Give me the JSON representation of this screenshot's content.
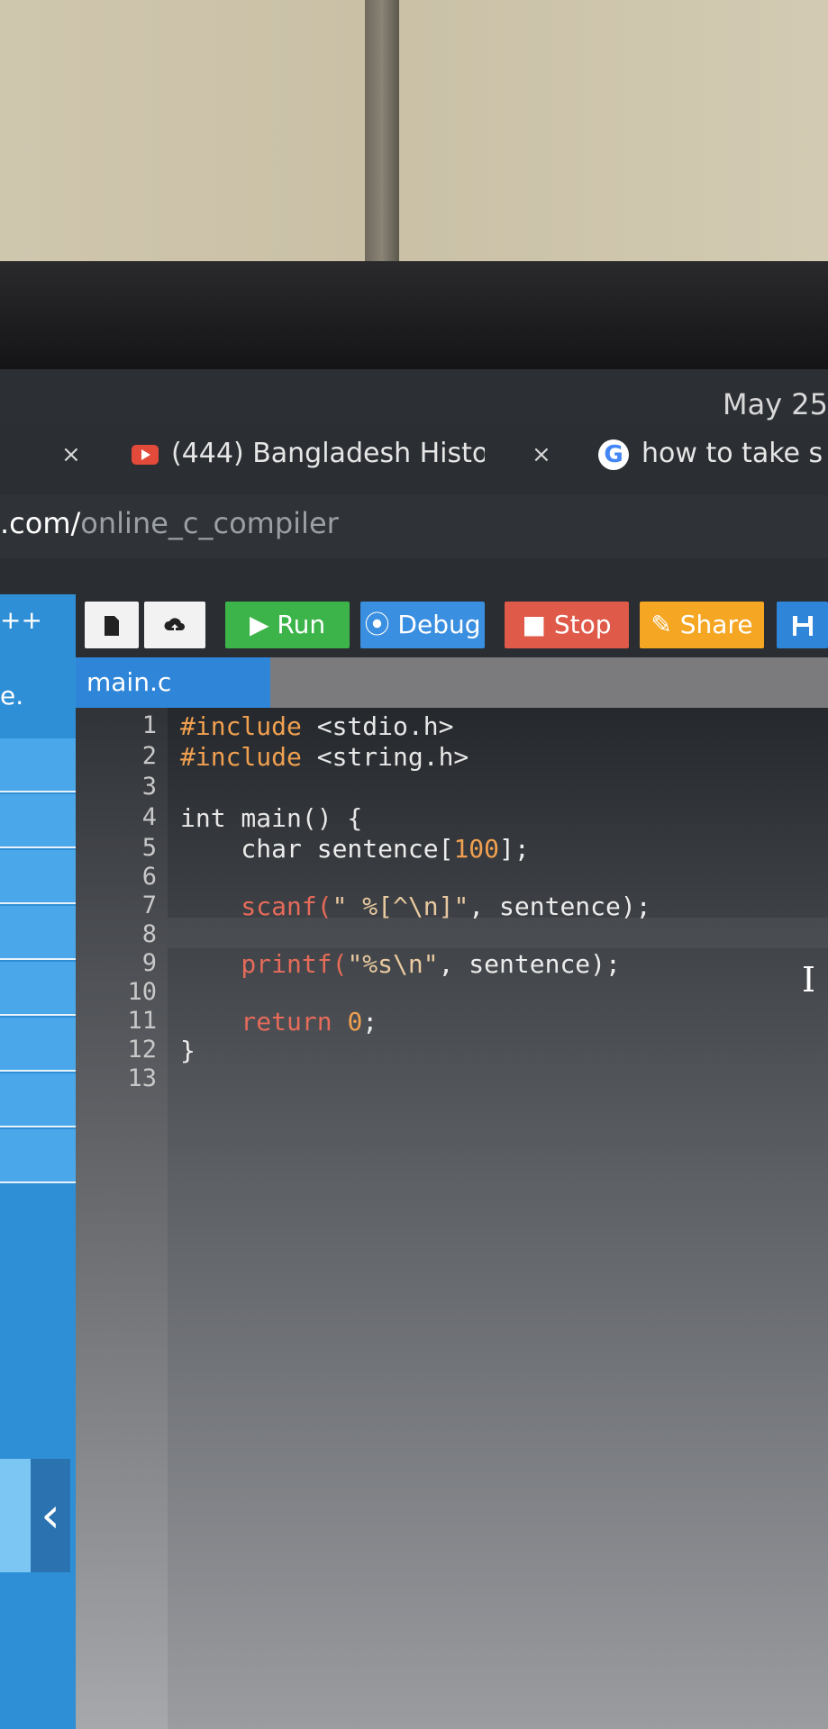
{
  "clock": "May 25",
  "tabs": [
    {
      "title": "(444) Bangladesh Histo",
      "close": "×"
    },
    {
      "title": "how to take s"
    }
  ],
  "tab_prev_close": "×",
  "url": {
    "domain": ".com/",
    "path": "online_c_compiler"
  },
  "sidebar": {
    "label1": "++",
    "label2": "e.",
    "collapse": "‹"
  },
  "toolbar": {
    "run": "▶ Run",
    "debug": "⦿ Debug",
    "stop": "■ Stop",
    "share": "✎ Share"
  },
  "file_tab": "main.c",
  "line_numbers": [
    "1",
    "2",
    "3",
    "4",
    "5",
    "6",
    "7",
    "8",
    "9",
    "10",
    "11",
    "12",
    "13"
  ],
  "code": {
    "l1_pre": "#include",
    "l1_hdr": " <stdio.h>",
    "l2_pre": "#include",
    "l2_hdr": " <string.h>",
    "l4": "int main() {",
    "l5a": "    char sentence[",
    "l5n": "100",
    "l5b": "];",
    "l7a": "    scanf(",
    "l7s": "\" %[^\\n]\"",
    "l7b": ", sentence);",
    "l9a": "    printf(",
    "l9s": "\"%s\\n\"",
    "l9b": ", sentence);",
    "l11a": "    return ",
    "l11n": "0",
    "l11b": ";",
    "l12": "}"
  },
  "colors": {
    "run": "#3cb44a",
    "debug": "#3b8fe0",
    "stop": "#e05a4a",
    "share": "#f5a623",
    "accent": "#2f86d8"
  }
}
